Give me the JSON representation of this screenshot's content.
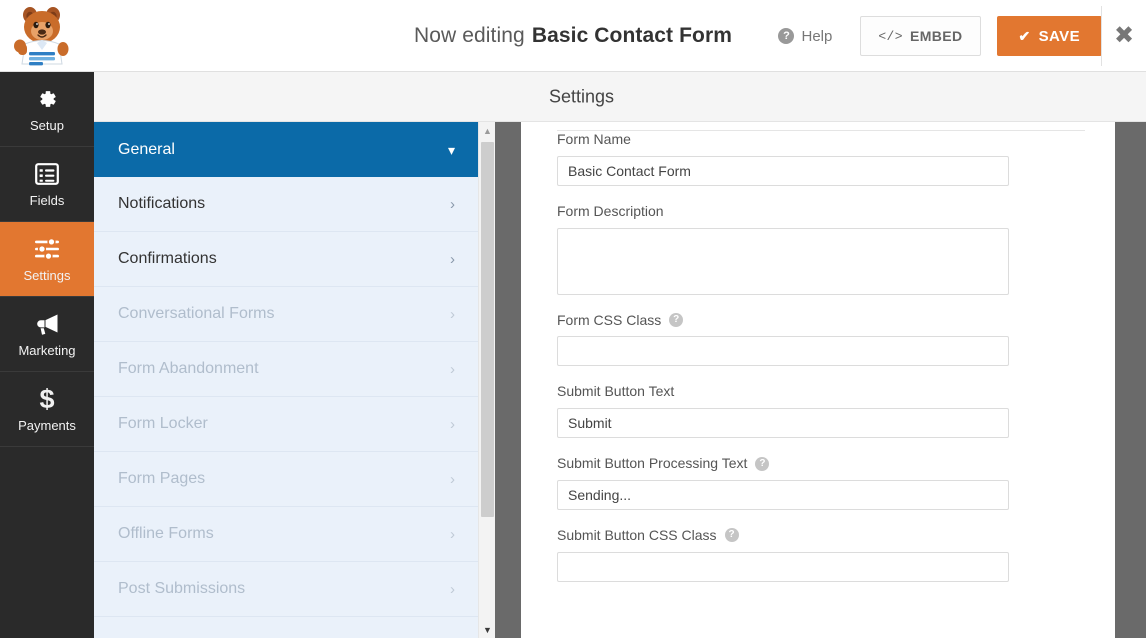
{
  "topbar": {
    "editing_prefix": "Now editing",
    "form_title": "Basic Contact Form",
    "help_label": "Help",
    "help_icon": "question-circle-icon",
    "embed_label": "EMBED",
    "embed_icon": "code-brackets-icon",
    "save_label": "SAVE",
    "save_icon": "check-icon",
    "close_icon": "close-x-icon",
    "save_color": "#e27730",
    "logo_icon": "wpforms-mascot-logo"
  },
  "rail": {
    "items": [
      {
        "label": "Setup",
        "icon": "gear-icon",
        "active": false
      },
      {
        "label": "Fields",
        "icon": "list-icon",
        "active": false
      },
      {
        "label": "Settings",
        "icon": "sliders-icon",
        "active": true
      },
      {
        "label": "Marketing",
        "icon": "megaphone-icon",
        "active": false
      },
      {
        "label": "Payments",
        "icon": "dollar-icon",
        "active": false
      }
    ],
    "active_color": "#e27730",
    "background_color": "#2a2a2a"
  },
  "panel": {
    "title": "Settings"
  },
  "settings_list": {
    "active_color": "#0b6aa8",
    "items": [
      {
        "label": "General",
        "state": "active",
        "chevron": "chevron-down-icon"
      },
      {
        "label": "Notifications",
        "state": "enabled",
        "chevron": "chevron-right-icon"
      },
      {
        "label": "Confirmations",
        "state": "enabled",
        "chevron": "chevron-right-icon"
      },
      {
        "label": "Conversational Forms",
        "state": "disabled",
        "chevron": "chevron-right-icon"
      },
      {
        "label": "Form Abandonment",
        "state": "disabled",
        "chevron": "chevron-right-icon"
      },
      {
        "label": "Form Locker",
        "state": "disabled",
        "chevron": "chevron-right-icon"
      },
      {
        "label": "Form Pages",
        "state": "disabled",
        "chevron": "chevron-right-icon"
      },
      {
        "label": "Offline Forms",
        "state": "disabled",
        "chevron": "chevron-right-icon"
      },
      {
        "label": "Post Submissions",
        "state": "disabled",
        "chevron": "chevron-right-icon"
      }
    ],
    "scrollbar": {
      "up_arrow": "scroll-up-arrow-icon",
      "down_arrow": "scroll-down-arrow-icon"
    }
  },
  "form": {
    "fields": [
      {
        "label": "Form Name",
        "value": "Basic Contact Form",
        "placeholder": "",
        "help": false,
        "type": "text"
      },
      {
        "label": "Form Description",
        "value": "",
        "placeholder": "",
        "help": false,
        "type": "textarea"
      },
      {
        "label": "Form CSS Class",
        "value": "",
        "placeholder": "",
        "help": true,
        "type": "text"
      },
      {
        "label": "Submit Button Text",
        "value": "Submit",
        "placeholder": "",
        "help": false,
        "type": "text"
      },
      {
        "label": "Submit Button Processing Text",
        "value": "Sending...",
        "placeholder": "",
        "help": true,
        "type": "text"
      },
      {
        "label": "Submit Button CSS Class",
        "value": "",
        "placeholder": "",
        "help": true,
        "type": "text"
      }
    ],
    "help_icon": "question-circle-icon"
  }
}
